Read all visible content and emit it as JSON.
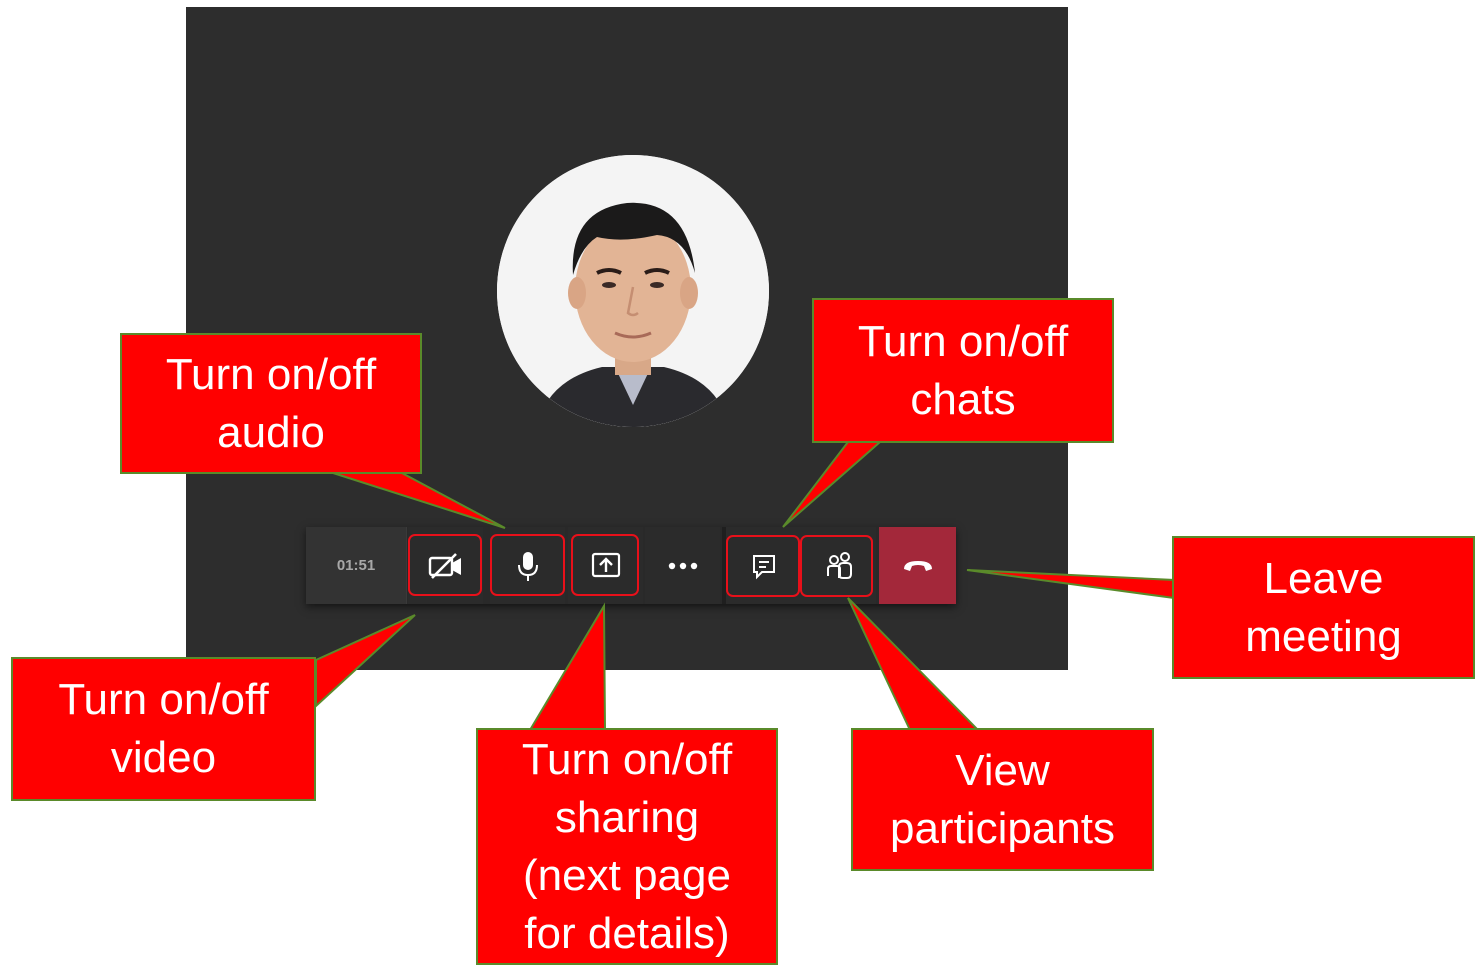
{
  "toolbar": {
    "timer": "01:51",
    "buttons": [
      {
        "name": "video",
        "icon": "video-off-icon"
      },
      {
        "name": "audio",
        "icon": "microphone-icon"
      },
      {
        "name": "share",
        "icon": "share-screen-icon"
      },
      {
        "name": "more",
        "icon": "more-options-icon"
      },
      {
        "name": "chat",
        "icon": "chat-icon"
      },
      {
        "name": "participants",
        "icon": "participants-icon"
      },
      {
        "name": "leave",
        "icon": "hang-up-icon"
      }
    ]
  },
  "callouts": {
    "audio": [
      "Turn on/off",
      "audio"
    ],
    "chats": [
      "Turn on/off",
      "chats"
    ],
    "video": [
      "Turn on/off",
      "video"
    ],
    "sharing": [
      "Turn on/off",
      "sharing",
      "(next page",
      "for details)"
    ],
    "participants": [
      "View",
      "participants"
    ],
    "leave": [
      "Leave",
      "meeting"
    ]
  },
  "colors": {
    "meeting_bg": "#2d2d2d",
    "toolbar_bg": "#292929",
    "leave_button": "#a3283a",
    "highlight": "#e8101a",
    "callout_fill": "#ff0000",
    "callout_border": "#5a8a2a"
  }
}
